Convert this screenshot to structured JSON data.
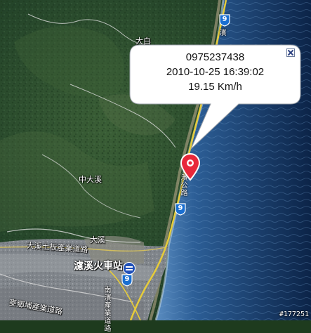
{
  "info_window": {
    "phone": "0975237438",
    "datetime": "2010-10-25 16:39:02",
    "speed": "19.15 Km/h"
  },
  "map_labels": {
    "village_dabai": "大白",
    "dadaxi": "中大溪",
    "daxi": "大溪",
    "daxi_industrial_road": "大溪土板產業道路",
    "station": "濾溪火車站",
    "pinglin_road": "麥鄉埔產業道路",
    "coastal_road_1": "濱公路",
    "coastal_road_top": "濱",
    "southbound_road": "南濱產業道路"
  },
  "road_shields": [
    {
      "number": "9"
    },
    {
      "number": "9"
    },
    {
      "number": "9"
    }
  ],
  "watermark": "#177251",
  "colors": {
    "marker": "#e8283a",
    "shield": "#1a6fd1",
    "ocean_deep": "#0e2a52",
    "ocean_shallow": "#3f73a8",
    "forest": "#2b4d2b",
    "riverbed": "#7d8288"
  }
}
